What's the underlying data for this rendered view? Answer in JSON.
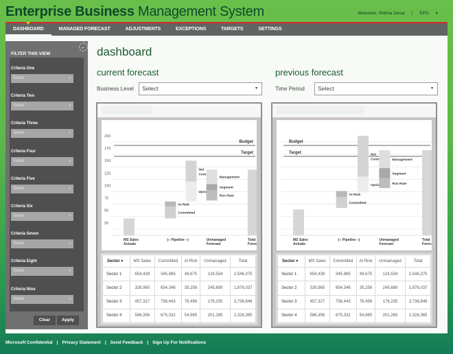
{
  "header": {
    "title_bold": "Enterprise Business",
    "title_light": "Management System",
    "welcome": "Welcome, Shikha Desai",
    "separator": "|",
    "org": "EPG",
    "org_caret": "▾"
  },
  "nav": {
    "items": [
      {
        "label": "DASHBOARD",
        "active": true
      },
      {
        "label": "MANAGED FORECAST"
      },
      {
        "label": "ADJUSTMENTS"
      },
      {
        "label": "EXCEPTIONS"
      },
      {
        "label": "TARGETS"
      },
      {
        "label": "SETTINGS"
      }
    ]
  },
  "sidebar": {
    "title": "FILTER THIS VIEW",
    "collapse_icon": "←",
    "criteria": [
      {
        "label": "Criteria One",
        "value": "Select"
      },
      {
        "label": "Criteria Two",
        "value": "Select"
      },
      {
        "label": "Criteria Three",
        "value": "Select"
      },
      {
        "label": "Criteria Four",
        "value": "Select"
      },
      {
        "label": "Criteria Five",
        "value": "Select"
      },
      {
        "label": "Criteria Six",
        "value": "Select"
      },
      {
        "label": "Criteria Seven",
        "value": "Select"
      },
      {
        "label": "Criteria Eight",
        "value": "Select"
      },
      {
        "label": "Criteria Nine",
        "value": "Select"
      }
    ],
    "select_caret": "▾",
    "clear_label": "Clear",
    "apply_label": "Apply"
  },
  "main": {
    "title": "dashboard",
    "current": {
      "title": "current forecast",
      "filter_label": "Business Level",
      "filter_value": "Select"
    },
    "previous": {
      "title": "previous forecast",
      "filter_label": "Time Period",
      "filter_value": "Select"
    },
    "dd_caret": "▾"
  },
  "chart_data": [
    {
      "type": "bar",
      "subtype": "waterfall",
      "title": "current forecast",
      "yticks": [
        25,
        50,
        75,
        100,
        125,
        150,
        175,
        200
      ],
      "ylim": [
        0,
        215
      ],
      "reference_lines": [
        {
          "label": "Budget",
          "value": 193
        },
        {
          "label": "Target",
          "value": 171
        }
      ],
      "categories": [
        "MS Sales Actuals",
        "|-- Pipeline --|",
        "Unmanaged Forecast",
        "Total Forecast"
      ],
      "segments": [
        {
          "label": "",
          "cat": 0,
          "from": 0,
          "to": 34
        },
        {
          "label": "Committed",
          "cat": 1,
          "from": 34,
          "to": 58
        },
        {
          "label": "At Risk",
          "cat": 1,
          "from": 58,
          "to": 68
        },
        {
          "label": "Upside",
          "cat": 1.5,
          "from": 68,
          "to": 108
        },
        {
          "label": "Not Committed",
          "cat": 1.5,
          "from": 108,
          "to": 150
        },
        {
          "label": "Run Rate",
          "cat": 2,
          "from": 70,
          "to": 91
        },
        {
          "label": "Segment",
          "cat": 2,
          "from": 91,
          "to": 103
        },
        {
          "label": "Management",
          "cat": 2,
          "from": 103,
          "to": 132
        },
        {
          "label": "",
          "cat": 3,
          "from": 0,
          "to": 132
        }
      ]
    },
    {
      "type": "bar",
      "subtype": "waterfall",
      "title": "previous forecast",
      "yticks": [],
      "ylim": [
        0,
        215
      ],
      "reference_lines": [
        {
          "label": "Budget",
          "value": 193
        },
        {
          "label": "Target",
          "value": 171
        }
      ],
      "categories": [
        "MS Sales Actuals",
        "|-- Pipeline --|",
        "Unmanaged Forecast",
        "Total Forecast"
      ],
      "segments": [
        {
          "label": "",
          "cat": 0,
          "from": 0,
          "to": 52
        },
        {
          "label": "Committed",
          "cat": 1,
          "from": 55,
          "to": 77
        },
        {
          "label": "At Risk",
          "cat": 1,
          "from": 77,
          "to": 89
        },
        {
          "label": "Upside",
          "cat": 1.5,
          "from": 86,
          "to": 118
        },
        {
          "label": "Not Committed",
          "cat": 1.5,
          "from": 118,
          "to": 200
        },
        {
          "label": "Run Rate",
          "cat": 2,
          "from": 95,
          "to": 115
        },
        {
          "label": "Segment",
          "cat": 2,
          "from": 115,
          "to": 135
        },
        {
          "label": "Management",
          "cat": 2,
          "from": 135,
          "to": 171
        },
        {
          "label": "",
          "cat": 3,
          "from": 0,
          "to": 171
        }
      ]
    }
  ],
  "table": {
    "headers": [
      "Sector",
      "MS Sales",
      "Committed",
      "At Risk",
      "Unmanaged",
      "Total"
    ],
    "sort_caret": "▾",
    "rows": [
      [
        "Sector 1",
        "654,439",
        "345,985",
        "49,675",
        "124,534",
        "2,546,375"
      ],
      [
        "Sector 2",
        "326,965",
        "654,346",
        "35,258",
        "245,689",
        "1,876,037"
      ],
      [
        "Sector 3",
        "457,327",
        "756,443",
        "76,456",
        "176,235",
        "3,736,846"
      ],
      [
        "Sector 4",
        "586,356",
        "675,332",
        "54,965",
        "201,285",
        "2,328,365"
      ]
    ]
  },
  "footer": {
    "links": [
      "Microsoft Confidential",
      "Privacy Statement",
      "Send Feedback",
      "Sign Up For Notifications"
    ],
    "separator": "|"
  }
}
